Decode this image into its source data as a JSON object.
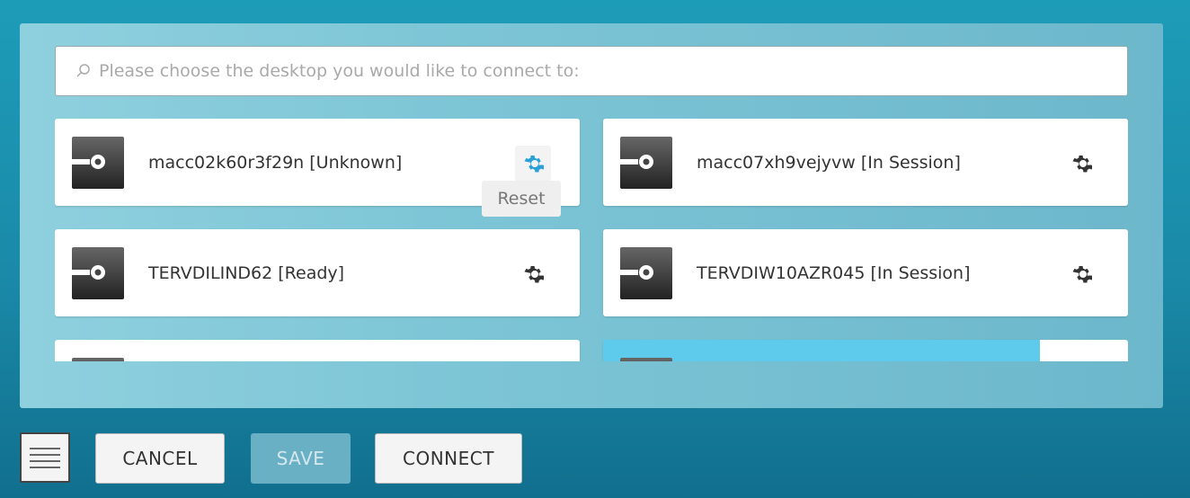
{
  "search": {
    "placeholder": "Please choose the desktop you would like to connect to:"
  },
  "desktops": [
    {
      "name": "macc02k60r3f29n [Unknown]",
      "status": "Unknown"
    },
    {
      "name": "macc07xh9vejyvw [In Session]",
      "status": "In Session"
    },
    {
      "name": "TERVDILIND62 [Ready]",
      "status": "Ready"
    },
    {
      "name": "TERVDIW10AZR045 [In Session]",
      "status": "In Session"
    },
    {
      "name": ""
    },
    {
      "name": ""
    }
  ],
  "tooltip": {
    "label": "Reset"
  },
  "buttons": {
    "cancel": "CANCEL",
    "save": "SAVE",
    "connect": "CONNECT"
  },
  "colors": {
    "accent": "#2aa0d8",
    "highlight_bar": "#5ecbec",
    "background": "#1a8aa8"
  },
  "icons": {
    "search": "search-icon",
    "desktop": "desktop-icon",
    "settings": "gear-icon",
    "menu": "hamburger-menu-icon"
  }
}
